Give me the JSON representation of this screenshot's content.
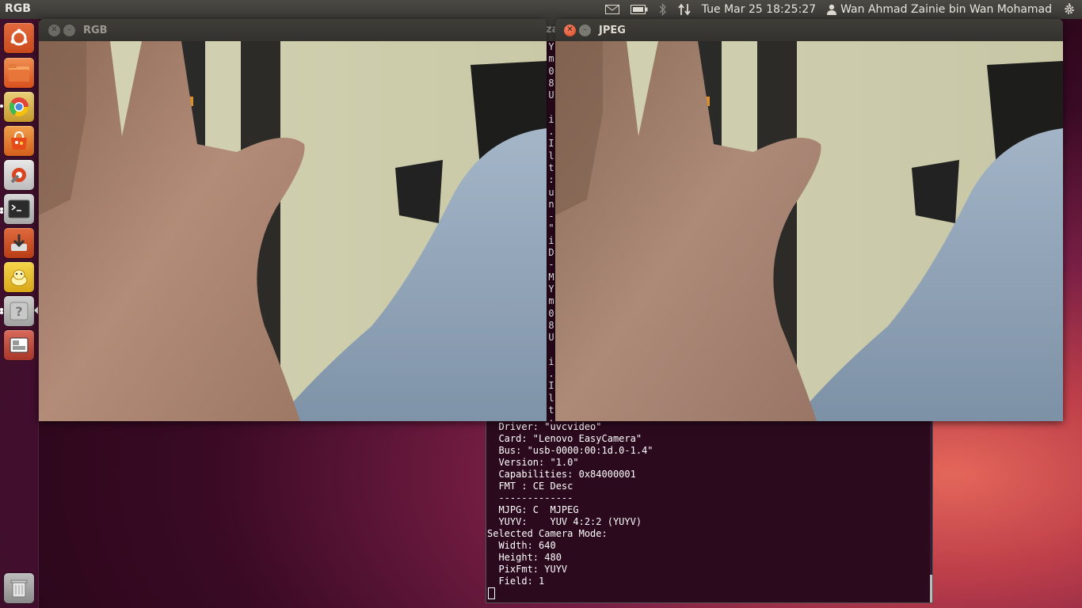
{
  "topbar": {
    "app_title": "RGB",
    "clock": "Tue Mar 25 18:25:27",
    "username": "Wan Ahmad Zainie bin Wan Mohamad",
    "indicators": [
      "mail-icon",
      "battery-icon",
      "bluetooth-icon",
      "network-icon",
      "user-icon",
      "gear-icon"
    ]
  },
  "launcher": {
    "items": [
      {
        "name": "dash-home-icon"
      },
      {
        "name": "files-icon"
      },
      {
        "name": "chrome-icon"
      },
      {
        "name": "software-center-icon"
      },
      {
        "name": "system-settings-icon"
      },
      {
        "name": "terminal-icon"
      },
      {
        "name": "update-manager-icon"
      },
      {
        "name": "app-icon"
      },
      {
        "name": "help-icon"
      },
      {
        "name": "workspace-switcher-icon"
      },
      {
        "name": "trash-icon"
      }
    ]
  },
  "windows": {
    "rgb": {
      "title": "RGB",
      "close": "✕",
      "minimize": "–"
    },
    "jpeg": {
      "title": "JPEG",
      "close": "✕",
      "minimize": "–"
    },
    "terminal_tab": {
      "title": "za"
    }
  },
  "terminal": {
    "narrow_column": "Y\nm\n0\n8\nU\n \ni\n.\nI\nl\nt\n:\nu\nn\n-\n\"\ni\nD\n-\nM\nY\nm\n0\n8\nU\n \ni\n.\nI\nl\nt\n:",
    "lines": [
      "  Driver: \"uvcvideo\"",
      "  Card: \"Lenovo EasyCamera\"",
      "  Bus: \"usb-0000:00:1d.0-1.4\"",
      "  Version: \"1.0\"",
      "  Capabilities: 0x84000001",
      "  FMT : CE Desc",
      "  -------------",
      "  MJPG: C  MJPEG",
      "  YUYV:    YUV 4:2:2 (YUYV)",
      "Selected Camera Mode:",
      "  Width: 640",
      "  Height: 480",
      "  PixFmt: YUYV",
      "  Field: 1"
    ]
  },
  "colors": {
    "accent": "#dd4814",
    "panel": "#3c3b37",
    "terminal_bg": "#2c0a1e"
  }
}
